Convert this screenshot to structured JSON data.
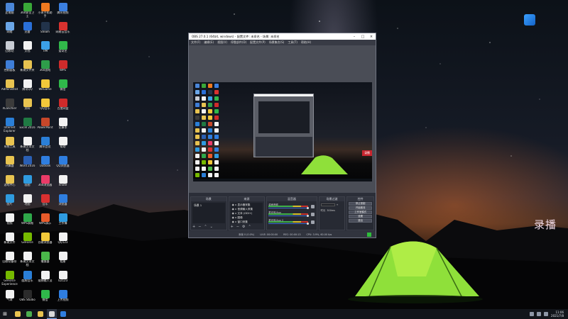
{
  "colors": {
    "obs_bg": "#2b2e38",
    "accent": "#3a6bd1",
    "status_green": "#2fbd3b",
    "tent_green": "#8fe03a"
  },
  "desktop": {
    "icons": [
      {
        "label": "此电脑",
        "color": "#4a86d8"
      },
      {
        "label": "360安全卫士",
        "color": "#39a838"
      },
      {
        "label": "小米手机助手",
        "color": "#f07a20"
      },
      {
        "label": "腾讯视频",
        "color": "#3b7fe0"
      },
      {
        "label": "网络",
        "color": "#6aa6e8"
      },
      {
        "label": "迅雷",
        "color": "#2a6fd8"
      },
      {
        "label": "Steam",
        "color": "#22334a"
      },
      {
        "label": "网易云音乐",
        "color": "#d8322f"
      },
      {
        "label": "回收站",
        "color": "#c8ccd4"
      },
      {
        "label": "文档",
        "color": "#f2f2f2"
      },
      {
        "label": "TIM",
        "color": "#3ba0e8"
      },
      {
        "label": "爱奇艺",
        "color": "#31b84a"
      },
      {
        "label": "控制面板",
        "color": "#3e7ed8"
      },
      {
        "label": "新建文件夹",
        "color": "#e8c350"
      },
      {
        "label": "360游戏",
        "color": "#2e9d4a"
      },
      {
        "label": "WPS",
        "color": "#cf2b2b"
      },
      {
        "label": "Administrator",
        "color": "#e8c350"
      },
      {
        "label": "腾讯QQ",
        "color": "#f2f2f2"
      },
      {
        "label": "WeGame",
        "color": "#f2c83a"
      },
      {
        "label": "微信",
        "color": "#2fb84a"
      },
      {
        "label": "XLanchier",
        "color": "#3b3b3b"
      },
      {
        "label": "资料",
        "color": "#e8c350"
      },
      {
        "label": "QQ音乐",
        "color": "#f2c83a"
      },
      {
        "label": "百度网盘",
        "color": "#cf2b2b"
      },
      {
        "label": "Internet Explorer",
        "color": "#2a7fd8"
      },
      {
        "label": "Excel 2016",
        "color": "#1f7a43"
      },
      {
        "label": "PowerPoint",
        "color": "#c7472a"
      },
      {
        "label": "记事本",
        "color": "#f2f2f2"
      },
      {
        "label": "系统工具",
        "color": "#e8c350"
      },
      {
        "label": "新建文本文档",
        "color": "#f2f2f2"
      },
      {
        "label": "腾讯会议",
        "color": "#2a7fd8"
      },
      {
        "label": "帮助",
        "color": "#f2f2f2"
      },
      {
        "label": "计算器",
        "color": "#e8c350"
      },
      {
        "label": "Word 2016",
        "color": "#2a5fb4"
      },
      {
        "label": "Outlook",
        "color": "#2f7ee0"
      },
      {
        "label": "QQ浏览器",
        "color": "#2f7ee0"
      },
      {
        "label": "游戏中心",
        "color": "#e8c350"
      },
      {
        "label": "画图",
        "color": "#2f9be0"
      },
      {
        "label": "360浏览器",
        "color": "#ea3b68"
      },
      {
        "label": "Xnote",
        "color": "#f2f2f2"
      },
      {
        "label": "图片",
        "color": "#2f9be0"
      },
      {
        "label": "地图",
        "color": "#f2f2f2"
      },
      {
        "label": "音乐",
        "color": "#d93030"
      },
      {
        "label": "浏览器",
        "color": "#2f7ee0"
      },
      {
        "label": "视频",
        "color": "#f2f2f2"
      },
      {
        "label": "WPS表格",
        "color": "#2fa84a"
      },
      {
        "label": "WPS演示",
        "color": "#e85a2a"
      },
      {
        "label": "工作簿",
        "color": "#2f9be0"
      },
      {
        "label": "新建文件",
        "color": "#f2f2f2"
      },
      {
        "label": "GeForce",
        "color": "#76b900"
      },
      {
        "label": "谷歌浏览器",
        "color": "#f2c83a"
      },
      {
        "label": "QQ123",
        "color": "#f2f2f2"
      },
      {
        "label": "回收站备份",
        "color": "#f2f2f2"
      },
      {
        "label": "新建文本文档",
        "color": "#f2f2f2"
      },
      {
        "label": "播放器",
        "color": "#4ab84a"
      },
      {
        "label": "相册",
        "color": "#f2f2f2"
      },
      {
        "label": "GeForce Experience",
        "color": "#76b900"
      },
      {
        "label": "酷狗音乐",
        "color": "#2a7fd8"
      },
      {
        "label": "搜狗输入法",
        "color": "#f2f2f2"
      },
      {
        "label": "G2123",
        "color": "#f2f2f2"
      },
      {
        "label": "气球",
        "color": "#f2f2f2"
      },
      {
        "label": "OBS Studio",
        "color": "#2b2b2b"
      },
      {
        "label": "微信",
        "color": "#2fb84a"
      },
      {
        "label": "上传视频",
        "color": "#2f7ee0"
      }
    ]
  },
  "overlay_text": "录播",
  "obs": {
    "title": "OBS 27.0.1 (64bit, windows) - 配置文件: 未命名 - 场景: 未命名",
    "menu": [
      "文件(F)",
      "编辑(E)",
      "视图(V)",
      "停靠部件(D)",
      "配置文件(P)",
      "场景集合(S)",
      "工具(T)",
      "帮助(H)"
    ],
    "preview_badge": "录播",
    "docks": {
      "scenes": {
        "header": "场景",
        "items": [
          "场景 1"
        ]
      },
      "sources": {
        "header": "来源",
        "items": [
          "显示器采集",
          "音频输入采集",
          "文本 (GDI+)",
          "图像",
          "窗口采集"
        ]
      },
      "mixer": {
        "header": "混音器",
        "rows": [
          "桌面音频",
          "麦克风/Aux",
          "麦克风/Aux 2"
        ]
      },
      "transitions": {
        "header": "场景过渡",
        "type_label": "淡出",
        "duration_label": "时长",
        "duration_value": "300ms"
      },
      "controls": {
        "header": "控件",
        "buttons": [
          "停止录制",
          "开始推流",
          "工作室模式",
          "设置",
          "退出"
        ]
      }
    },
    "status": [
      "丢帧 0 (0.0%)",
      "LIVE: 00:00:00",
      "REC: 00:00:13",
      "CPU: 3.9%, 60.00 fps"
    ]
  },
  "taskbar": {
    "apps": [
      {
        "name": "file-explorer",
        "color": "#e8c350",
        "active": false
      },
      {
        "name": "chrome",
        "color": "#4caf50",
        "active": false
      },
      {
        "name": "folder",
        "color": "#e8c350",
        "active": false
      },
      {
        "name": "obs",
        "color": "#d9d9d9",
        "active": true
      },
      {
        "name": "browser",
        "color": "#2f7ee0",
        "active": false
      }
    ],
    "clock_time": "11:06",
    "clock_date": "2021/7/8"
  }
}
